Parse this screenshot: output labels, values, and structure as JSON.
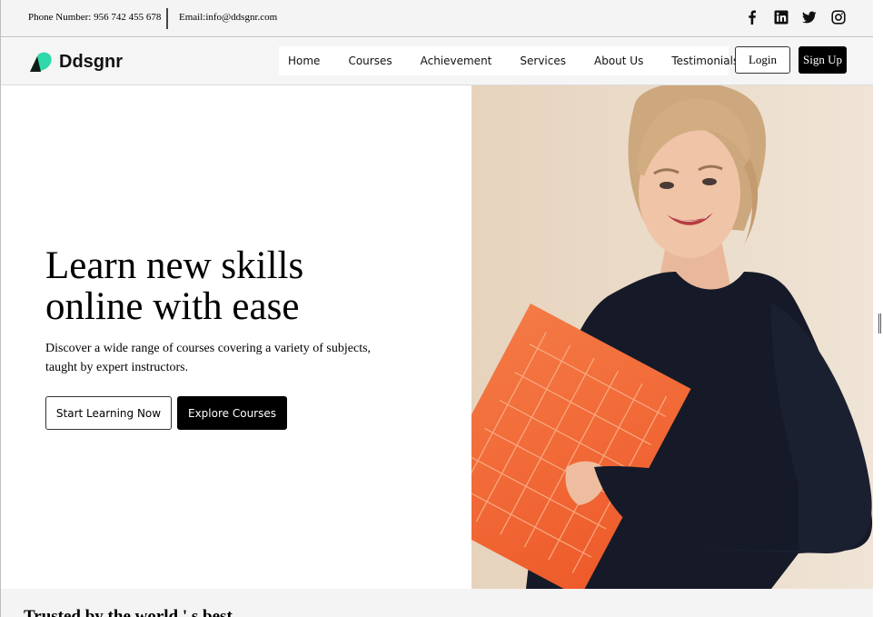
{
  "topbar": {
    "phone": "Phone Number: 956 742 455 678",
    "email": "Email:info@ddsgnr.com",
    "social_icons": [
      "facebook-icon",
      "linkedin-icon",
      "twitter-icon",
      "instagram-icon"
    ]
  },
  "brand": {
    "name": "Ddsgnr",
    "accent": "#2fd8a8"
  },
  "nav": {
    "links": [
      "Home",
      "Courses",
      "Achievement",
      "Services",
      "About Us",
      "Testimonials"
    ],
    "login_label": "Login",
    "sign_label": "Sign Up"
  },
  "hero": {
    "headline_line1": "Learn new skills",
    "headline_line2": "online with ease",
    "subtext": "Discover a wide range of courses covering a variety of subjects, taught by expert instructors.",
    "primary_button": "Start Learning Now",
    "secondary_button": "Explore Courses",
    "image_alt": "Smiling woman holding an orange folder"
  },
  "trusted": {
    "heading": "Trusted by the world ' s best"
  },
  "colors": {
    "topbar_bg": "#f4f4f4",
    "hero_image_bg": "#ead9c6",
    "sweater": "#161a28",
    "folder": "#f2622f"
  }
}
